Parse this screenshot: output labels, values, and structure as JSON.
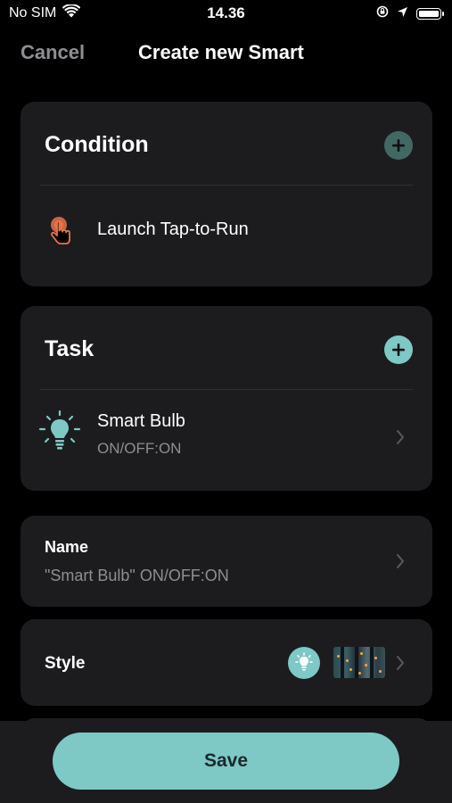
{
  "status_bar": {
    "carrier": "No SIM",
    "time": "14.36"
  },
  "nav": {
    "cancel_label": "Cancel",
    "title": "Create new Smart"
  },
  "condition": {
    "heading": "Condition",
    "item_label": "Launch Tap-to-Run"
  },
  "task": {
    "heading": "Task",
    "item_title": "Smart Bulb",
    "item_status": "ON/OFF:ON"
  },
  "name_section": {
    "label": "Name",
    "value": "\"Smart Bulb\" ON/OFF:ON"
  },
  "style_section": {
    "label": "Style"
  },
  "footer": {
    "save_label": "Save"
  },
  "colors": {
    "accent": "#7ec8c6",
    "accent_disabled": "#426864",
    "tap_icon": "#e8734a",
    "card_bg": "#1c1c1e",
    "secondary_text": "#8e8e93"
  },
  "icons": {
    "wifi": "wifi-icon",
    "location": "location-arrow-icon",
    "orientation_lock": "orientation-lock-icon",
    "battery": "battery-icon",
    "tap": "tap-hand-icon",
    "bulb": "light-bulb-icon",
    "add": "plus-circle-icon",
    "chevron": "chevron-right-icon"
  }
}
